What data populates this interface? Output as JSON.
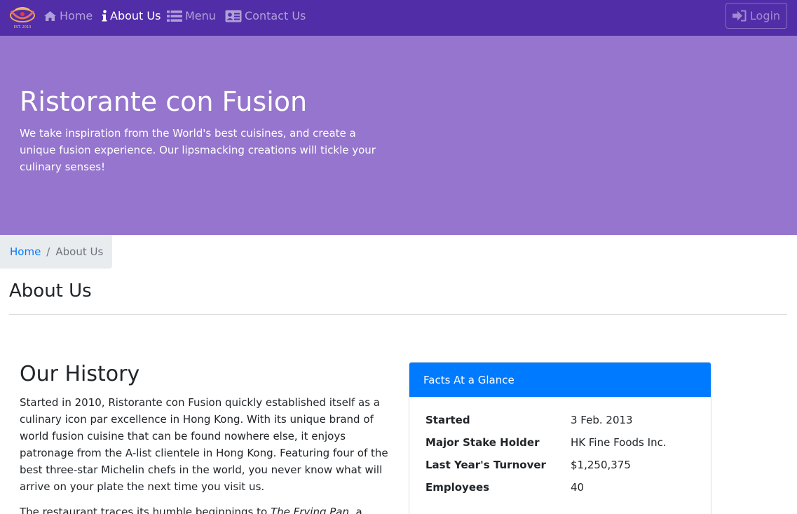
{
  "navbar": {
    "brand_alt": "Ristorante con Fusion logo",
    "home_label": "Home",
    "about_label": "About Us",
    "menu_label": "Menu",
    "contact_label": "Contact Us",
    "login_label": "Login",
    "icons": {
      "home": "home-icon",
      "about": "info-icon",
      "menu": "list-icon",
      "contact": "address-card-icon",
      "login": "sign-in-icon"
    }
  },
  "jumbotron": {
    "title": "Ristorante con Fusion",
    "text": "We take inspiration from the World's best cuisines, and create a unique fusion experience. Our lipsmacking creations will tickle your culinary senses!"
  },
  "breadcrumb": {
    "home": "Home",
    "separator": "/",
    "current": "About Us"
  },
  "page": {
    "heading": "About Us"
  },
  "history": {
    "title": "Our History",
    "paragraph1": "Started in 2010, Ristorante con Fusion quickly established itself as a culinary icon par excellence in Hong Kong. With its unique brand of world fusion cuisine that can be found nowhere else, it enjoys patronage from the A-list clientele in Hong Kong. Featuring four of the best three-star Michelin chefs in the world, you never know what will arrive on your plate the next time you visit us.",
    "paragraph2_start": "The restaurant traces its humble beginnings to ",
    "paragraph2_italic": "The Frying Pan",
    "paragraph2_end": ", a"
  },
  "facts": {
    "header": "Facts At a Glance",
    "rows": [
      {
        "label": "Started",
        "value": "3 Feb. 2013"
      },
      {
        "label": "Major Stake Holder",
        "value": "HK Fine Foods Inc."
      },
      {
        "label": "Last Year's Turnover",
        "value": "$1,250,375"
      },
      {
        "label": "Employees",
        "value": "40"
      }
    ]
  },
  "colors": {
    "navbar": "#512da8",
    "jumbotron": "#9575cd",
    "card_header": "#007bff",
    "link": "#007bff"
  }
}
